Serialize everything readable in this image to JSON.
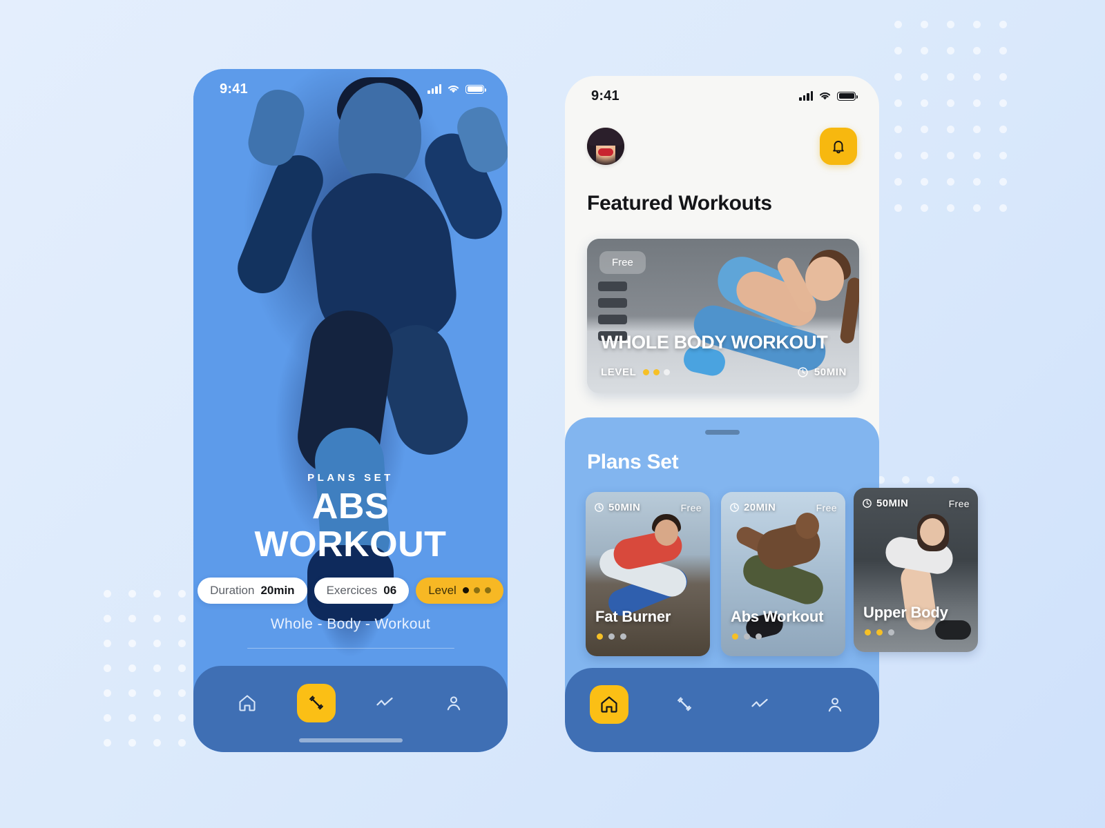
{
  "background": {
    "color": "#e4eefd",
    "accent_blue": "#5d9bea",
    "accent_yellow": "#f7b80f",
    "nav_bar_color": "#3f6fb4",
    "sheet_color": "#82b5ef"
  },
  "screen_left": {
    "status": {
      "time": "9:41",
      "signal_icon": "signal-bars-icon",
      "wifi_icon": "wifi-icon",
      "battery_icon": "battery-icon"
    },
    "hero": {
      "kicker": "PLANS SET",
      "title": "ABS WORKOUT",
      "subtitle": "Whole - Body - Workout",
      "chips": [
        {
          "label": "Duration",
          "value": "20min"
        },
        {
          "label": "Exercices",
          "value": "06"
        }
      ],
      "level_chip": {
        "label": "Level",
        "dots_total": 3,
        "dots_filled": 1
      }
    },
    "nav": [
      {
        "name": "home",
        "icon": "home-icon",
        "active": false
      },
      {
        "name": "workout",
        "icon": "dumbbell-icon",
        "active": true
      },
      {
        "name": "stats",
        "icon": "chart-line-icon",
        "active": false
      },
      {
        "name": "profile",
        "icon": "person-icon",
        "active": false
      }
    ]
  },
  "screen_right": {
    "status": {
      "time": "9:41",
      "signal_icon": "signal-bars-icon",
      "wifi_icon": "wifi-icon",
      "battery_icon": "battery-icon"
    },
    "header": {
      "avatar_icon": "user-avatar-photo",
      "notification_icon": "bell-icon"
    },
    "featured_section": {
      "title": "Featured Workouts"
    },
    "featured_card": {
      "badge": "Free",
      "title": "WHOLE BODY WORKOUT",
      "level_label": "LEVEL",
      "level_dots_total": 3,
      "level_dots_filled": 2,
      "duration": "50MIN",
      "clock_icon": "clock-icon"
    },
    "plans_section": {
      "title": "Plans Set"
    },
    "plan_cards": [
      {
        "duration": "50MIN",
        "price": "Free",
        "title": "Fat Burner",
        "level_dots_total": 3,
        "level_dots_filled": 1,
        "clock_icon": "clock-icon"
      },
      {
        "duration": "20MIN",
        "price": "Free",
        "title": "Abs Workout",
        "level_dots_total": 3,
        "level_dots_filled": 1,
        "clock_icon": "clock-icon"
      },
      {
        "duration": "50MIN",
        "price": "Free",
        "title": "Upper Body",
        "level_dots_total": 3,
        "level_dots_filled": 2,
        "clock_icon": "clock-icon"
      }
    ],
    "nav": [
      {
        "name": "home",
        "icon": "home-icon",
        "active": true
      },
      {
        "name": "workout",
        "icon": "dumbbell-icon",
        "active": false
      },
      {
        "name": "stats",
        "icon": "chart-line-icon",
        "active": false
      },
      {
        "name": "profile",
        "icon": "person-icon",
        "active": false
      }
    ]
  }
}
